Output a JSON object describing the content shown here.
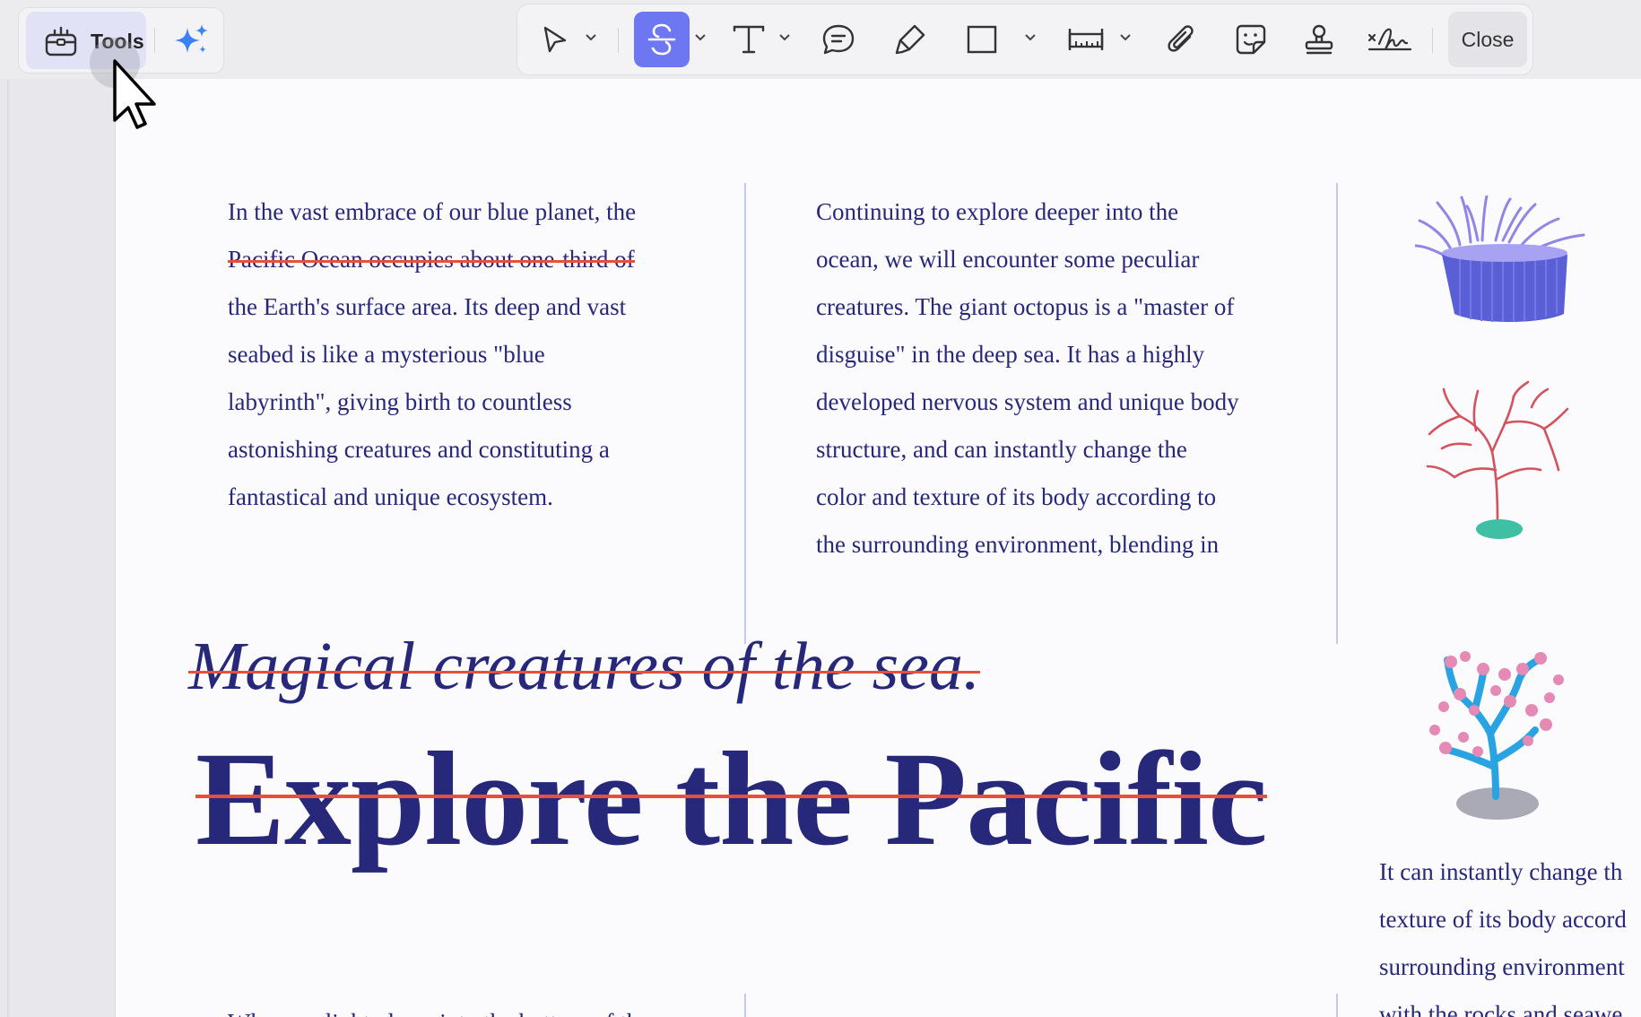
{
  "toolbar": {
    "tools_label": "Tools",
    "close_label": "Close",
    "colors": {
      "active_tool_bg": "#6e77f2",
      "ai_accent": "#3b82f6"
    },
    "tools": [
      {
        "name": "select",
        "icon": "pointer-arrow-icon",
        "has_dropdown": true
      },
      {
        "name": "strikethrough",
        "icon": "strikethrough-icon",
        "has_dropdown": true,
        "active": true
      },
      {
        "name": "text",
        "icon": "text-t-icon",
        "has_dropdown": true
      },
      {
        "name": "comment",
        "icon": "comment-bubble-icon",
        "has_dropdown": false
      },
      {
        "name": "highlight",
        "icon": "highlighter-pen-icon",
        "has_dropdown": false
      },
      {
        "name": "shape",
        "icon": "rectangle-icon",
        "has_dropdown": true
      },
      {
        "name": "measure",
        "icon": "ruler-icon",
        "has_dropdown": true
      },
      {
        "name": "attach",
        "icon": "paperclip-icon",
        "has_dropdown": false
      },
      {
        "name": "sticker",
        "icon": "sticker-icon",
        "has_dropdown": false
      },
      {
        "name": "stamp",
        "icon": "stamp-icon",
        "has_dropdown": false
      },
      {
        "name": "signature",
        "icon": "signature-icon",
        "has_dropdown": false
      }
    ]
  },
  "document": {
    "column1": {
      "line1": "In the vast embrace of our blue planet, the",
      "line2": "Pacific Ocean occupies about one-third of",
      "line3": "the Earth's surface area. Its deep and vast",
      "line4": "seabed is like a mysterious \"blue",
      "line5": "labyrinth\", giving birth to countless",
      "line6": "astonishing creatures and constituting a",
      "line7": "fantastical and unique ecosystem."
    },
    "column2": {
      "line1": "Continuing to explore deeper into the",
      "line2": "ocean, we will encounter some peculiar",
      "line3": "creatures. The giant octopus is a \"master of",
      "line4": "disguise\" in the deep sea. It has a highly",
      "line5": "developed nervous system and unique body",
      "line6": "structure, and can instantly change the",
      "line7": "color and texture of its body according to",
      "line8": "the surrounding environment, blending in"
    },
    "subtitle": "Magical creatures of the sea.",
    "headline": "Explore the Pacific",
    "column3": {
      "line1": "It can instantly change th",
      "line2": "texture of its body accord",
      "line3": "surrounding environment",
      "line4": "with the rocks and seawe"
    },
    "bottom_peek": "When sunlight glows into the bottom of the",
    "annotation_color": "#e8503c",
    "text_color": "#28287a"
  }
}
